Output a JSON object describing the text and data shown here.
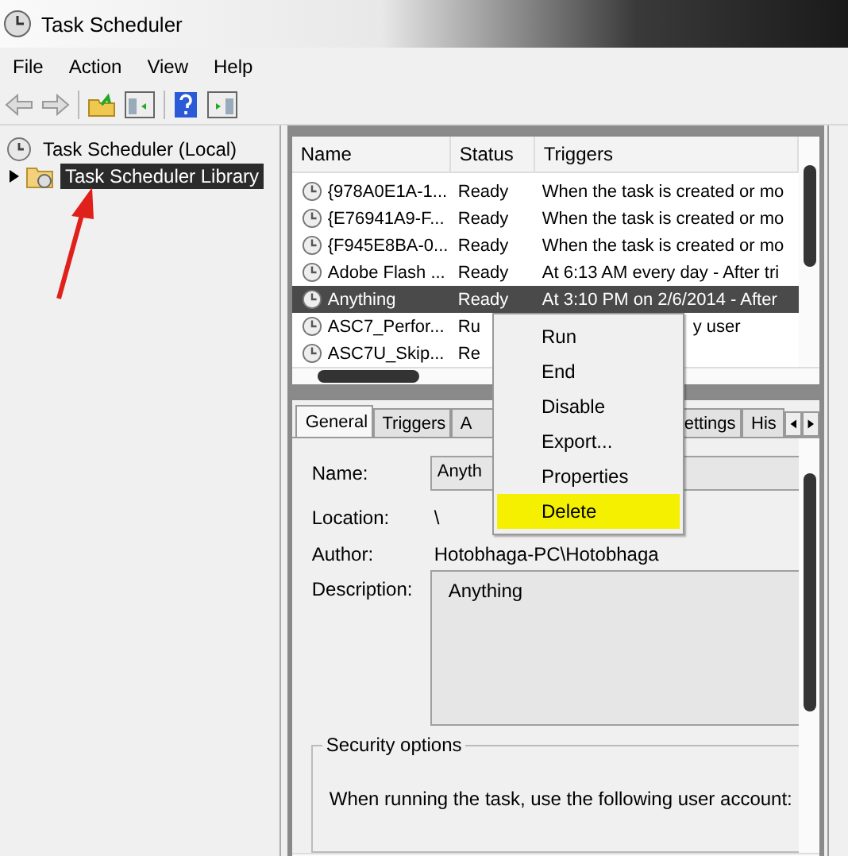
{
  "window": {
    "title": "Task Scheduler"
  },
  "menu_bar": [
    "File",
    "Action",
    "View",
    "Help"
  ],
  "tree": [
    {
      "label": "Task Scheduler (Local)",
      "selected": false,
      "children": [
        {
          "label": "Task Scheduler Library",
          "selected": true,
          "expanded": false
        }
      ]
    }
  ],
  "task_table": {
    "columns": [
      "Name",
      "Status",
      "Triggers"
    ],
    "rows": [
      {
        "name": "{978A0E1A-1...",
        "status": "Ready",
        "triggers": "When the task is created or mo",
        "selected": false
      },
      {
        "name": "{E76941A9-F...",
        "status": "Ready",
        "triggers": "When the task is created or mo",
        "selected": false
      },
      {
        "name": "{F945E8BA-0...",
        "status": "Ready",
        "triggers": "When the task is created or mo",
        "selected": false
      },
      {
        "name": "Adobe Flash ...",
        "status": "Ready",
        "triggers": "At 6:13 AM every day - After tri",
        "selected": false
      },
      {
        "name": "Anything",
        "status": "Ready",
        "triggers": "At 3:10 PM on 2/6/2014 - After",
        "selected": true
      },
      {
        "name": "ASC7_Perfor...",
        "status": "Ru",
        "triggers": "y user",
        "selected": false
      },
      {
        "name": "ASC7U_Skip...",
        "status": "Re",
        "selected": false
      }
    ]
  },
  "detail_tabs": [
    {
      "label": "General",
      "selected": true
    },
    {
      "label": "Triggers",
      "selected": false
    },
    {
      "label": "A",
      "selected": false
    },
    {
      "label": "ettings",
      "selected": false
    },
    {
      "label": "His",
      "selected": false
    }
  ],
  "general": {
    "name_label": "Name:",
    "name_value": "Anyth",
    "location_label": "Location:",
    "location_value": "\\",
    "author_label": "Author:",
    "author_value": "Hotobhaga-PC\\Hotobhaga",
    "description_label": "Description:",
    "description_value": "Anything",
    "security_title": "Security options",
    "security_text": "When running the task, use the following user account:"
  },
  "context_menu": [
    {
      "label": "Run",
      "highlighted": false
    },
    {
      "label": "End",
      "highlighted": false
    },
    {
      "label": "Disable",
      "highlighted": false
    },
    {
      "label": "Export...",
      "highlighted": false
    },
    {
      "label": "Properties",
      "highlighted": false
    },
    {
      "label": "Delete",
      "highlighted": true
    }
  ]
}
